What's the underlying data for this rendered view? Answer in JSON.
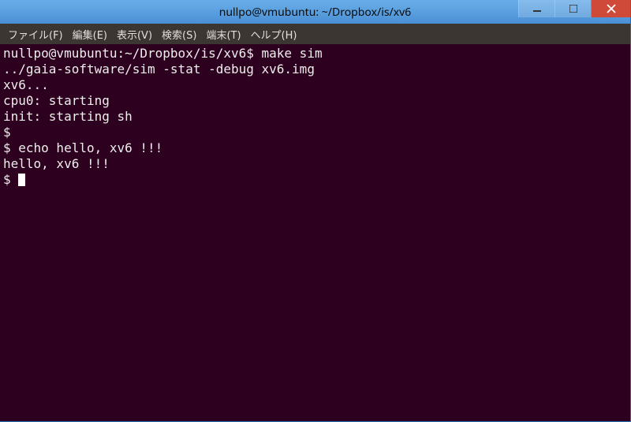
{
  "titlebar": {
    "title": "nullpo@vmubuntu: ~/Dropbox/is/xv6"
  },
  "menubar": {
    "items": [
      {
        "label": "ファイル(F)"
      },
      {
        "label": "編集(E)"
      },
      {
        "label": "表示(V)"
      },
      {
        "label": "検索(S)"
      },
      {
        "label": "端末(T)"
      },
      {
        "label": "ヘルプ(H)"
      }
    ]
  },
  "terminal": {
    "lines": [
      "nullpo@vmubuntu:~/Dropbox/is/xv6$ make sim",
      "../gaia-software/sim -stat -debug xv6.img",
      "xv6...",
      "cpu0: starting",
      "init: starting sh",
      "$",
      "$ echo hello, xv6 !!!",
      "hello, xv6 !!!",
      "$ "
    ]
  },
  "colors": {
    "titlebar_top": "#6aaee8",
    "titlebar_bottom": "#4a8fd4",
    "close_button": "#d04a3a",
    "menubar_bg": "#3b3632",
    "terminal_bg": "#2c001e",
    "terminal_fg": "#eeeeec"
  }
}
